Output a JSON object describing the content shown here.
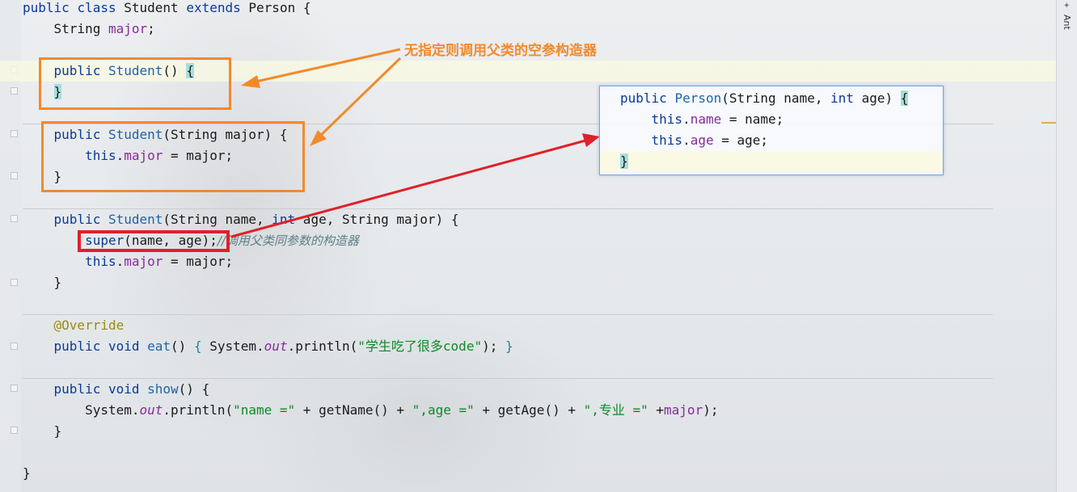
{
  "annotation": {
    "note": "无指定则调用父类的空参构造器",
    "colors": {
      "orange": "#f28a2c",
      "red": "#e0202a"
    }
  },
  "code": {
    "l1": {
      "kw1": "public",
      "kw2": "class",
      "name": "Student",
      "kw3": "extends",
      "parent": "Person",
      "brace": "{"
    },
    "l2": {
      "type": "String",
      "field": "major",
      "semi": ";"
    },
    "ctor1": {
      "kw": "public",
      "name": "Student",
      "parens": "()",
      "open": "{",
      "close": "}"
    },
    "ctor2": {
      "kw": "public",
      "name": "Student",
      "params": "(String major) {",
      "this": "this",
      "dot": ".",
      "field": "major",
      "rest": " = major;",
      "close": "}"
    },
    "ctor3": {
      "kw": "public",
      "name": "Student",
      "p1": "(String name, ",
      "int": "int",
      "p2": " age, String major) {",
      "super": "super",
      "superargs": "(name, age);",
      "comment": "//调用父类同参数的构造器",
      "this": "this",
      "dot": ".",
      "field": "major",
      "rest": " = major;",
      "close": "}"
    },
    "eat": {
      "annotation": "@Override",
      "kw1": "public",
      "kw2": "void",
      "name": "eat",
      "parens": "()",
      "open": "{",
      "sys": "System.",
      "out": "out",
      "println": ".println(",
      "str": "\"学生吃了很多code\"",
      "end": ");",
      "close": "}"
    },
    "show": {
      "kw1": "public",
      "kw2": "void",
      "name": "show",
      "sig": "() {",
      "sys": "System.",
      "out": "out",
      "println": ".println(",
      "s1": "\"name =\"",
      "c1": " + getName() + ",
      "s2": "\",age =\"",
      "c2": " + getAge() + ",
      "s3": "\",专业 =\"",
      "c3": " +",
      "field": "major",
      "end": ");",
      "close": "}"
    },
    "final_close": "}"
  },
  "popup": {
    "kw": "public",
    "name": "Person",
    "p1": "(String name, ",
    "int": "int",
    "p2": " age) ",
    "open": "{",
    "this": "this",
    "dot": ".",
    "f1": "name",
    "r1": " = name;",
    "f2": "age",
    "r2": " = age;",
    "close": "}"
  },
  "sidebar": {
    "ant_label": "Ant",
    "icon": "ant-icon"
  }
}
